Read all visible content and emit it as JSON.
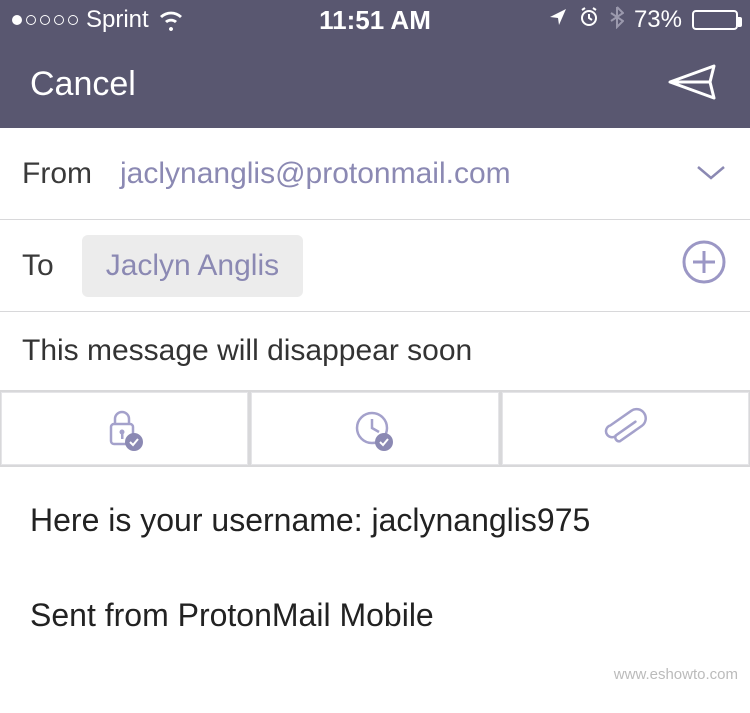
{
  "status": {
    "carrier": "Sprint",
    "time": "11:51 AM",
    "battery_pct": "73%"
  },
  "nav": {
    "cancel": "Cancel"
  },
  "from": {
    "label": "From",
    "value": "jaclynanglis@protonmail.com"
  },
  "to": {
    "label": "To",
    "chip": "Jaclyn Anglis"
  },
  "subject": "This message will disappear soon",
  "body": {
    "line1": "Here is your username: jaclynanglis975",
    "line2": "Sent from ProtonMail Mobile"
  },
  "watermark": "www.eshowto.com"
}
